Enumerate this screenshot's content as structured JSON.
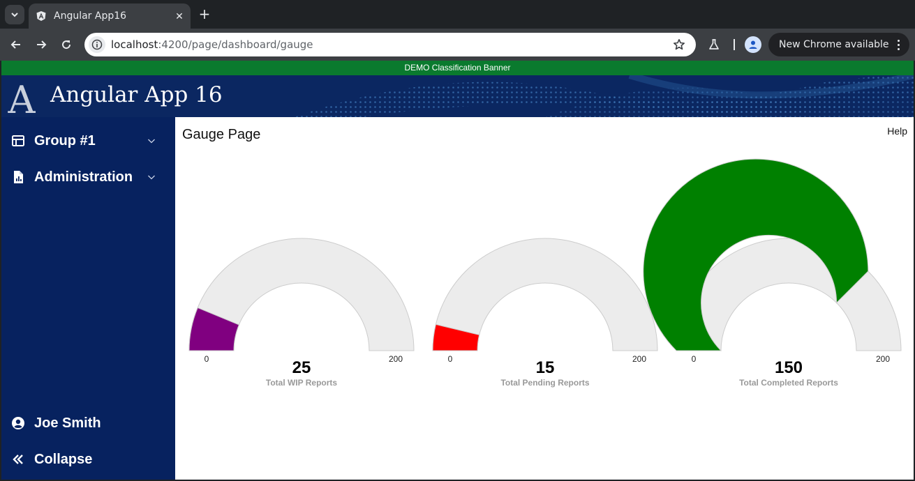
{
  "browser": {
    "tab_title": "Angular App16",
    "tab_close": "✕",
    "new_tab": "+",
    "url_host": "localhost",
    "url_rest": ":4200/page/dashboard/gauge",
    "update_label": "New Chrome available"
  },
  "app": {
    "banner": "DEMO Classification Banner",
    "logo_letter": "A",
    "title": "Angular App 16"
  },
  "sidebar": {
    "items": [
      {
        "label": "Group #1",
        "icon": "dashboard-icon"
      },
      {
        "label": "Administration",
        "icon": "report-icon"
      }
    ],
    "user": {
      "label": "Joe Smith",
      "icon": "account-circle-icon"
    },
    "collapse": {
      "label": "Collapse",
      "icon": "double-chevron-left-icon"
    }
  },
  "main": {
    "title": "Gauge Page",
    "help": "Help"
  },
  "chart_data": [
    {
      "type": "gauge",
      "value": 25,
      "min": 0,
      "max": 200,
      "min_label": "0",
      "max_label": "200",
      "label": "Total WIP Reports",
      "color": "#800080"
    },
    {
      "type": "gauge",
      "value": 15,
      "min": 0,
      "max": 200,
      "min_label": "0",
      "max_label": "200",
      "label": "Total Pending Reports",
      "color": "#ff0000"
    },
    {
      "type": "gauge",
      "value": 150,
      "min": 0,
      "max": 200,
      "min_label": "0",
      "max_label": "200",
      "label": "Total Completed Reports",
      "color": "#008000"
    }
  ],
  "colors": {
    "gauge_track": "#ececec",
    "sidebar": "#07225f",
    "banner": "#0a7a2e"
  }
}
